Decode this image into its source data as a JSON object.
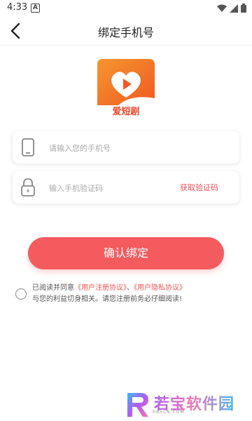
{
  "status_bar": {
    "time": "4:33",
    "notification_letter": "A"
  },
  "nav": {
    "title": "绑定手机号"
  },
  "logo": {
    "caption": "爱短剧",
    "primary_color": "#f4852a",
    "accent_color": "#e8472a"
  },
  "phone_field": {
    "placeholder": "请输入您的手机号",
    "icon": "phone-icon"
  },
  "code_field": {
    "placeholder": "输入手机验证码",
    "icon": "lock-icon",
    "get_code_label": "获取验证码"
  },
  "confirm_button": {
    "label": "确认绑定",
    "color": "#f45b5f"
  },
  "agreement": {
    "prefix": "已阅读并同意",
    "user_agreement": "《用户注册协议》",
    "separator": "、",
    "privacy_agreement": "《用户隐私协议》",
    "suffix": "与您的利益切身相关。请您注册前务必仔细阅读!"
  },
  "watermark": {
    "text": "若宝软件园",
    "sub": "RBSCN.COM"
  }
}
